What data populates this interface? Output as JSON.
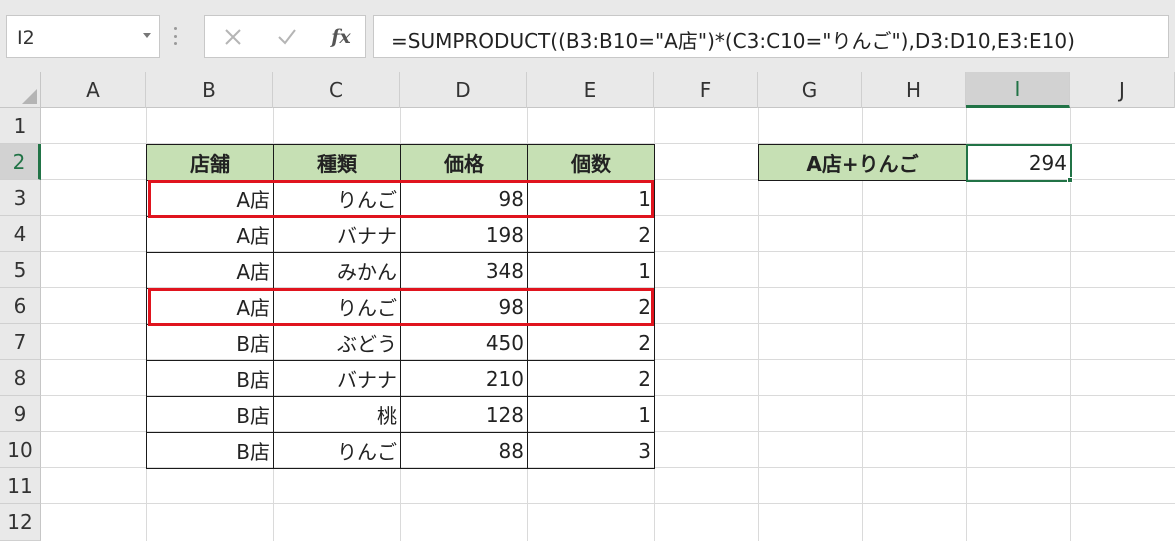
{
  "formula_bar": {
    "name_box": "I2",
    "cancel_icon": "cancel-icon",
    "enter_icon": "checkmark-icon",
    "fx_label": "fx",
    "formula": "=SUMPRODUCT((B3:B10=\"A店\")*(C3:C10=\"りんご\"),D3:D10,E3:E10)"
  },
  "columns": [
    "A",
    "B",
    "C",
    "D",
    "E",
    "F",
    "G",
    "H",
    "I",
    "J"
  ],
  "active_column": "I",
  "rows": [
    "1",
    "2",
    "3",
    "4",
    "5",
    "6",
    "7",
    "8",
    "9",
    "10",
    "11",
    "12"
  ],
  "active_row": "2",
  "table": {
    "headers": [
      "店舗",
      "種類",
      "価格",
      "個数"
    ],
    "rows": [
      [
        "A店",
        "りんご",
        "98",
        "1"
      ],
      [
        "A店",
        "バナナ",
        "198",
        "2"
      ],
      [
        "A店",
        "みかん",
        "348",
        "1"
      ],
      [
        "A店",
        "りんご",
        "98",
        "2"
      ],
      [
        "B店",
        "ぶどう",
        "450",
        "2"
      ],
      [
        "B店",
        "バナナ",
        "210",
        "2"
      ],
      [
        "B店",
        "桃",
        "128",
        "1"
      ],
      [
        "B店",
        "りんご",
        "88",
        "3"
      ]
    ],
    "highlighted_rows": [
      "3",
      "6"
    ],
    "highlight_color": "#e0141e"
  },
  "result": {
    "label": "A店+りんご",
    "value": "294"
  },
  "colors": {
    "header_fill": "#c6e0b4",
    "selection": "#217346"
  }
}
